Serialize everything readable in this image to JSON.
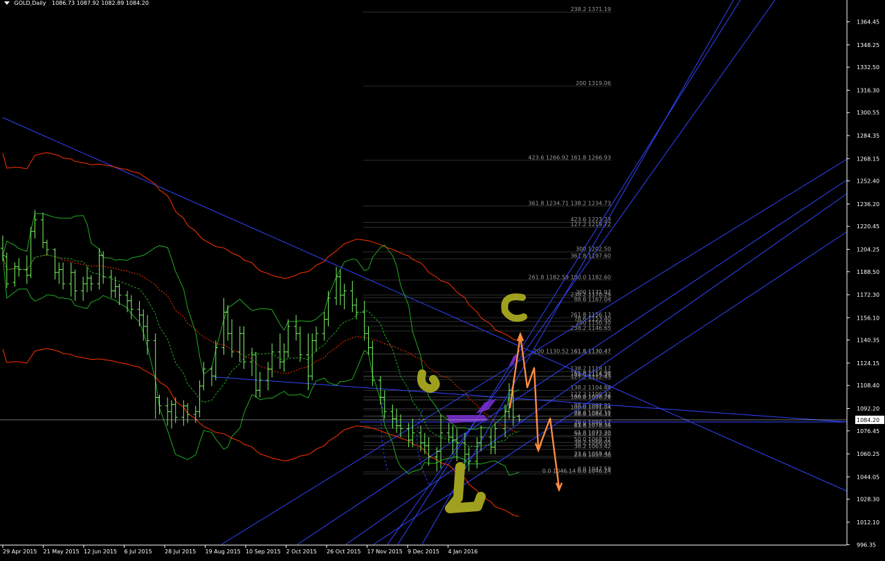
{
  "header": {
    "symbol": "GOLD,Daily",
    "ohlc": "1086.73 1087.92 1082.89 1084.20"
  },
  "colors": {
    "background": "#000000",
    "axis": "#ffffff",
    "candles": "#7cfc64",
    "bollinger": "#22aa22",
    "envelope": "#ff3300",
    "trendline": "#3344ff",
    "fibo": "#888888",
    "price_line": "#ffffff",
    "drawing_orange": "#ff8c40",
    "drawing_purple": "#7b2fd4",
    "drawing_olive": "#a0a020"
  },
  "chart_data": {
    "type": "candlestick",
    "title": "GOLD,Daily",
    "current_price": "1084.20",
    "ylim": [
      996,
      1373
    ],
    "y_ticks": [
      {
        "value": 1364.45,
        "label": "1364.45"
      },
      {
        "value": 1348.25,
        "label": "1348.25"
      },
      {
        "value": 1332.5,
        "label": "1332.50"
      },
      {
        "value": 1316.3,
        "label": "1316.30"
      },
      {
        "value": 1300.55,
        "label": "1300.55"
      },
      {
        "value": 1284.35,
        "label": "1284.35"
      },
      {
        "value": 1268.15,
        "label": "1268.15"
      },
      {
        "value": 1252.4,
        "label": "1252.40"
      },
      {
        "value": 1236.2,
        "label": "1236.20"
      },
      {
        "value": 1220.45,
        "label": "1220.45"
      },
      {
        "value": 1204.25,
        "label": "1204.25"
      },
      {
        "value": 1188.5,
        "label": "1188.50"
      },
      {
        "value": 1172.3,
        "label": "1172.30"
      },
      {
        "value": 1156.1,
        "label": "1156.10"
      },
      {
        "value": 1140.35,
        "label": "1140.35"
      },
      {
        "value": 1124.15,
        "label": "1124.15"
      },
      {
        "value": 1108.4,
        "label": "1108.40"
      },
      {
        "value": 1092.2,
        "label": "1092.20"
      },
      {
        "value": 1076.45,
        "label": "1076.45"
      },
      {
        "value": 1060.25,
        "label": "1060.25"
      },
      {
        "value": 1044.05,
        "label": "1044.05"
      },
      {
        "value": 1028.3,
        "label": "1028.30"
      },
      {
        "value": 1012.1,
        "label": "1012.10"
      },
      {
        "value": 996.35,
        "label": "996.35"
      }
    ],
    "x_ticks": [
      "29 Apr 2015",
      "21 May 2015",
      "12 Jun 2015",
      "6 Jul 2015",
      "28 Jul 2015",
      "19 Aug 2015",
      "10 Sep 2015",
      "2 Oct 2015",
      "26 Oct 2015",
      "17 Nov 2015",
      "9 Dec 2015",
      "4 Jan 2016"
    ],
    "fibo_levels": [
      {
        "label": "238.2  1371.19",
        "value": 1371.19
      },
      {
        "label": "200  1319.06",
        "value": 1319.06
      },
      {
        "label": "423.6  1266.92   161.8  1266.93",
        "value": 1266.92
      },
      {
        "label": "361.8  1234.71   138.2  1234.73",
        "value": 1234.72
      },
      {
        "label": "423.6  1223.23",
        "value": 1223.23
      },
      {
        "label": "127.2  1219.72",
        "value": 1219.72
      },
      {
        "label": "300  1202.50",
        "value": 1202.5
      },
      {
        "label": "361.8  1197.60",
        "value": 1197.6
      },
      {
        "label": "261.8  1182.59   100.0  1182.60",
        "value": 1182.6
      },
      {
        "label": "300  1171.97",
        "value": 1171.97
      },
      {
        "label": "238.2  1170.29",
        "value": 1170.29
      },
      {
        "label": "88.6  1167.04",
        "value": 1167.04
      },
      {
        "label": "261.8  1156.13",
        "value": 1156.13
      },
      {
        "label": "78.6  1153.40",
        "value": 1153.4
      },
      {
        "label": "200  1150.30",
        "value": 1150.3
      },
      {
        "label": "238.2  1146.65",
        "value": 1146.65
      },
      {
        "label": "200  1130.52   161.8  1130.47",
        "value": 1130.5
      },
      {
        "label": "61.8  1130.47",
        "value": 1130.47
      },
      {
        "label": "138.2  1118.17",
        "value": 1118.17
      },
      {
        "label": "161.8  1114.96",
        "value": 1114.96
      },
      {
        "label": "50.0  1114.37",
        "value": 1114.37
      },
      {
        "label": "127.2  1112.43",
        "value": 1112.43
      },
      {
        "label": "138.2  1104.88",
        "value": 1104.88
      },
      {
        "label": "127.2  1100.32",
        "value": 1100.32
      },
      {
        "label": "100.0  1098.26",
        "value": 1098.26
      },
      {
        "label": "38.2  1098.27",
        "value": 1098.27
      },
      {
        "label": "88.6  1092.31",
        "value": 1092.31
      },
      {
        "label": "100.0  1091.04",
        "value": 1091.04
      },
      {
        "label": "78.6  1087.10",
        "value": 1087.1
      },
      {
        "label": "88.6  1086.31",
        "value": 1086.31
      },
      {
        "label": "78.6  1080.17",
        "value": 1080.17
      },
      {
        "label": "61.8  1078.35",
        "value": 1078.35
      },
      {
        "label": "23.6  1078.34",
        "value": 1078.34
      },
      {
        "label": "61.8  1073.20",
        "value": 1073.2
      },
      {
        "label": "50.0  1072.20",
        "value": 1072.2
      },
      {
        "label": "50.0  1068.31",
        "value": 1068.31
      },
      {
        "label": "38.2  1066.05",
        "value": 1066.05
      },
      {
        "label": "38.2  1063.42",
        "value": 1063.42
      },
      {
        "label": "23.6  1058.44",
        "value": 1058.44
      },
      {
        "label": "23.6  1057.36",
        "value": 1057.36
      },
      {
        "label": "0.0  1047.58",
        "value": 1047.58
      },
      {
        "label": "0.0  1046.14   0.0  1046.14",
        "value": 1046.14
      }
    ],
    "candles": [
      {
        "date": "2015-04-29",
        "o": 1205,
        "h": 1214,
        "l": 1196,
        "c": 1200
      },
      {
        "date": "2015-05-01",
        "o": 1199,
        "h": 1202,
        "l": 1177,
        "c": 1180
      },
      {
        "date": "2015-05-05",
        "o": 1181,
        "h": 1195,
        "l": 1178,
        "c": 1192
      },
      {
        "date": "2015-05-07",
        "o": 1192,
        "h": 1198,
        "l": 1185,
        "c": 1190
      },
      {
        "date": "2015-05-11",
        "o": 1190,
        "h": 1200,
        "l": 1180,
        "c": 1186
      },
      {
        "date": "2015-05-13",
        "o": 1186,
        "h": 1220,
        "l": 1184,
        "c": 1217
      },
      {
        "date": "2015-05-15",
        "o": 1217,
        "h": 1232,
        "l": 1212,
        "c": 1225
      },
      {
        "date": "2015-05-19",
        "o": 1225,
        "h": 1230,
        "l": 1205,
        "c": 1209
      },
      {
        "date": "2015-05-21",
        "o": 1209,
        "h": 1211,
        "l": 1200,
        "c": 1204
      },
      {
        "date": "2015-05-25",
        "o": 1204,
        "h": 1205,
        "l": 1183,
        "c": 1188
      },
      {
        "date": "2015-05-27",
        "o": 1188,
        "h": 1195,
        "l": 1180,
        "c": 1190
      },
      {
        "date": "2015-05-29",
        "o": 1190,
        "h": 1195,
        "l": 1176,
        "c": 1180
      },
      {
        "date": "2015-06-02",
        "o": 1180,
        "h": 1195,
        "l": 1171,
        "c": 1188
      },
      {
        "date": "2015-06-04",
        "o": 1188,
        "h": 1190,
        "l": 1168,
        "c": 1175
      },
      {
        "date": "2015-06-08",
        "o": 1175,
        "h": 1185,
        "l": 1168,
        "c": 1180
      },
      {
        "date": "2015-06-10",
        "o": 1180,
        "h": 1192,
        "l": 1174,
        "c": 1184
      },
      {
        "date": "2015-06-12",
        "o": 1184,
        "h": 1186,
        "l": 1175,
        "c": 1180
      },
      {
        "date": "2015-06-16",
        "o": 1180,
        "h": 1205,
        "l": 1176,
        "c": 1200
      },
      {
        "date": "2015-06-18",
        "o": 1200,
        "h": 1203,
        "l": 1180,
        "c": 1185
      },
      {
        "date": "2015-06-22",
        "o": 1185,
        "h": 1190,
        "l": 1170,
        "c": 1175
      },
      {
        "date": "2015-06-24",
        "o": 1175,
        "h": 1185,
        "l": 1170,
        "c": 1178
      },
      {
        "date": "2015-06-26",
        "o": 1178,
        "h": 1180,
        "l": 1165,
        "c": 1172
      },
      {
        "date": "2015-06-30",
        "o": 1172,
        "h": 1175,
        "l": 1160,
        "c": 1168
      },
      {
        "date": "2015-07-02",
        "o": 1168,
        "h": 1172,
        "l": 1155,
        "c": 1162
      },
      {
        "date": "2015-07-06",
        "o": 1162,
        "h": 1168,
        "l": 1150,
        "c": 1158
      },
      {
        "date": "2015-07-08",
        "o": 1158,
        "h": 1162,
        "l": 1140,
        "c": 1150
      },
      {
        "date": "2015-07-10",
        "o": 1150,
        "h": 1158,
        "l": 1130,
        "c": 1140
      },
      {
        "date": "2015-07-14",
        "o": 1140,
        "h": 1145,
        "l": 1085,
        "c": 1100
      },
      {
        "date": "2015-07-16",
        "o": 1100,
        "h": 1102,
        "l": 1088,
        "c": 1094
      },
      {
        "date": "2015-07-20",
        "o": 1094,
        "h": 1100,
        "l": 1080,
        "c": 1090
      },
      {
        "date": "2015-07-22",
        "o": 1090,
        "h": 1098,
        "l": 1078,
        "c": 1095
      },
      {
        "date": "2015-07-24",
        "o": 1095,
        "h": 1100,
        "l": 1082,
        "c": 1086
      },
      {
        "date": "2015-07-28",
        "o": 1086,
        "h": 1098,
        "l": 1080,
        "c": 1094
      },
      {
        "date": "2015-07-30",
        "o": 1094,
        "h": 1096,
        "l": 1082,
        "c": 1088
      },
      {
        "date": "2015-08-03",
        "o": 1088,
        "h": 1094,
        "l": 1082,
        "c": 1090
      },
      {
        "date": "2015-08-05",
        "o": 1090,
        "h": 1112,
        "l": 1086,
        "c": 1108
      },
      {
        "date": "2015-08-07",
        "o": 1108,
        "h": 1125,
        "l": 1105,
        "c": 1120
      },
      {
        "date": "2015-08-11",
        "o": 1120,
        "h": 1122,
        "l": 1108,
        "c": 1115
      },
      {
        "date": "2015-08-13",
        "o": 1115,
        "h": 1140,
        "l": 1112,
        "c": 1135
      },
      {
        "date": "2015-08-17",
        "o": 1135,
        "h": 1170,
        "l": 1130,
        "c": 1160
      },
      {
        "date": "2015-08-19",
        "o": 1160,
        "h": 1165,
        "l": 1140,
        "c": 1145
      },
      {
        "date": "2015-08-21",
        "o": 1145,
        "h": 1155,
        "l": 1128,
        "c": 1132
      },
      {
        "date": "2015-08-25",
        "o": 1132,
        "h": 1150,
        "l": 1125,
        "c": 1145
      },
      {
        "date": "2015-08-27",
        "o": 1145,
        "h": 1150,
        "l": 1120,
        "c": 1125
      },
      {
        "date": "2015-08-31",
        "o": 1125,
        "h": 1135,
        "l": 1115,
        "c": 1130
      },
      {
        "date": "2015-09-02",
        "o": 1130,
        "h": 1132,
        "l": 1100,
        "c": 1105
      },
      {
        "date": "2015-09-04",
        "o": 1105,
        "h": 1118,
        "l": 1100,
        "c": 1112
      },
      {
        "date": "2015-09-08",
        "o": 1112,
        "h": 1125,
        "l": 1105,
        "c": 1120
      },
      {
        "date": "2015-09-10",
        "o": 1120,
        "h": 1138,
        "l": 1114,
        "c": 1132
      },
      {
        "date": "2015-09-14",
        "o": 1132,
        "h": 1145,
        "l": 1120,
        "c": 1125
      },
      {
        "date": "2015-09-16",
        "o": 1125,
        "h": 1138,
        "l": 1118,
        "c": 1132
      },
      {
        "date": "2015-09-18",
        "o": 1132,
        "h": 1155,
        "l": 1128,
        "c": 1150
      },
      {
        "date": "2015-09-22",
        "o": 1150,
        "h": 1158,
        "l": 1140,
        "c": 1145
      },
      {
        "date": "2015-09-24",
        "o": 1145,
        "h": 1150,
        "l": 1125,
        "c": 1130
      },
      {
        "date": "2015-09-28",
        "o": 1130,
        "h": 1145,
        "l": 1105,
        "c": 1115
      },
      {
        "date": "2015-09-30",
        "o": 1115,
        "h": 1145,
        "l": 1112,
        "c": 1140
      },
      {
        "date": "2015-10-02",
        "o": 1140,
        "h": 1150,
        "l": 1132,
        "c": 1145
      },
      {
        "date": "2015-10-06",
        "o": 1145,
        "h": 1160,
        "l": 1140,
        "c": 1155
      },
      {
        "date": "2015-10-08",
        "o": 1155,
        "h": 1175,
        "l": 1150,
        "c": 1170
      },
      {
        "date": "2015-10-12",
        "o": 1170,
        "h": 1192,
        "l": 1165,
        "c": 1185
      },
      {
        "date": "2015-10-14",
        "o": 1185,
        "h": 1190,
        "l": 1165,
        "c": 1172
      },
      {
        "date": "2015-10-16",
        "o": 1172,
        "h": 1180,
        "l": 1162,
        "c": 1175
      },
      {
        "date": "2015-10-20",
        "o": 1175,
        "h": 1182,
        "l": 1160,
        "c": 1165
      },
      {
        "date": "2015-10-22",
        "o": 1165,
        "h": 1170,
        "l": 1155,
        "c": 1160
      },
      {
        "date": "2015-10-26",
        "o": 1160,
        "h": 1168,
        "l": 1140,
        "c": 1145
      },
      {
        "date": "2015-10-28",
        "o": 1145,
        "h": 1150,
        "l": 1130,
        "c": 1135
      },
      {
        "date": "2015-10-30",
        "o": 1135,
        "h": 1140,
        "l": 1108,
        "c": 1112
      },
      {
        "date": "2015-11-03",
        "o": 1112,
        "h": 1115,
        "l": 1095,
        "c": 1100
      },
      {
        "date": "2015-11-05",
        "o": 1100,
        "h": 1105,
        "l": 1085,
        "c": 1090
      },
      {
        "date": "2015-11-09",
        "o": 1090,
        "h": 1095,
        "l": 1078,
        "c": 1085
      },
      {
        "date": "2015-11-11",
        "o": 1085,
        "h": 1092,
        "l": 1075,
        "c": 1080
      },
      {
        "date": "2015-11-13",
        "o": 1080,
        "h": 1088,
        "l": 1072,
        "c": 1078
      },
      {
        "date": "2015-11-17",
        "o": 1078,
        "h": 1082,
        "l": 1065,
        "c": 1070
      },
      {
        "date": "2015-11-19",
        "o": 1070,
        "h": 1085,
        "l": 1065,
        "c": 1075
      },
      {
        "date": "2015-11-23",
        "o": 1075,
        "h": 1080,
        "l": 1062,
        "c": 1068
      },
      {
        "date": "2015-11-25",
        "o": 1068,
        "h": 1075,
        "l": 1060,
        "c": 1066
      },
      {
        "date": "2015-11-27",
        "o": 1066,
        "h": 1072,
        "l": 1052,
        "c": 1058
      },
      {
        "date": "2015-12-01",
        "o": 1058,
        "h": 1065,
        "l": 1048,
        "c": 1062
      },
      {
        "date": "2015-12-03",
        "o": 1062,
        "h": 1088,
        "l": 1050,
        "c": 1075
      },
      {
        "date": "2015-12-07",
        "o": 1075,
        "h": 1082,
        "l": 1068,
        "c": 1072
      },
      {
        "date": "2015-12-09",
        "o": 1072,
        "h": 1080,
        "l": 1060,
        "c": 1070
      },
      {
        "date": "2015-12-11",
        "o": 1070,
        "h": 1078,
        "l": 1055,
        "c": 1068
      },
      {
        "date": "2015-12-15",
        "o": 1068,
        "h": 1075,
        "l": 1050,
        "c": 1060
      },
      {
        "date": "2015-12-17",
        "o": 1060,
        "h": 1065,
        "l": 1048,
        "c": 1055
      },
      {
        "date": "2015-12-21",
        "o": 1055,
        "h": 1072,
        "l": 1050,
        "c": 1068
      },
      {
        "date": "2015-12-23",
        "o": 1068,
        "h": 1080,
        "l": 1062,
        "c": 1072
      },
      {
        "date": "2015-12-28",
        "o": 1072,
        "h": 1078,
        "l": 1060,
        "c": 1065
      },
      {
        "date": "2015-12-30",
        "o": 1065,
        "h": 1082,
        "l": 1060,
        "c": 1078
      },
      {
        "date": "2016-01-04",
        "o": 1078,
        "h": 1095,
        "l": 1072,
        "c": 1090
      },
      {
        "date": "2016-01-06",
        "o": 1090,
        "h": 1110,
        "l": 1085,
        "c": 1105
      },
      {
        "date": "2016-01-08",
        "o": 1105,
        "h": 1112,
        "l": 1080,
        "c": 1086
      },
      {
        "date": "2016-01-11",
        "o": 1086.73,
        "h": 1087.92,
        "l": 1082.89,
        "c": 1084.2
      }
    ]
  }
}
